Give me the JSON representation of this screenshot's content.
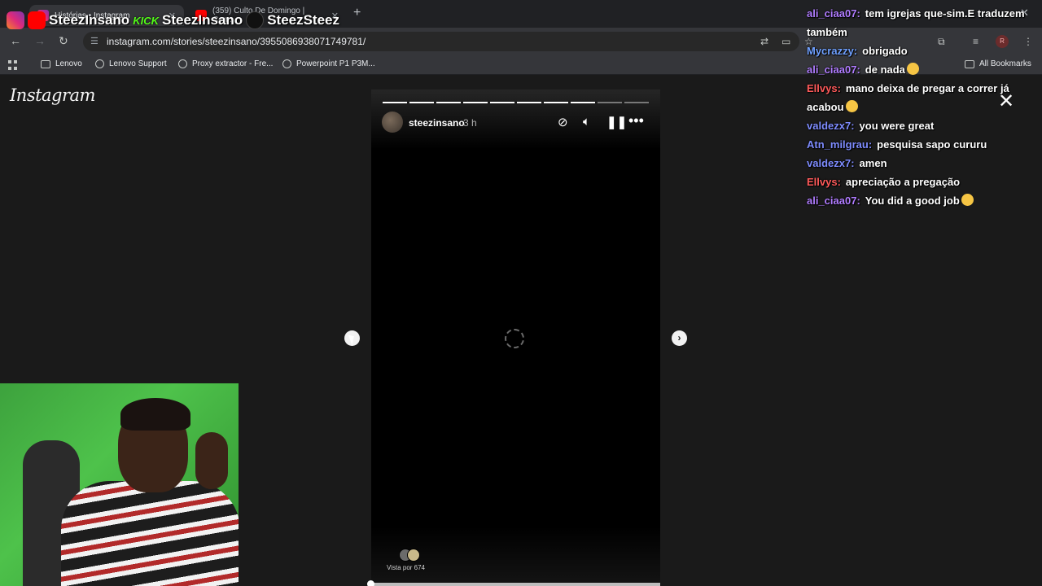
{
  "browser": {
    "tabs": [
      {
        "title": "Histórias • Instagram",
        "favicon": "instagram-icon",
        "active": true
      },
      {
        "title": "(359) Culto De Domingo | Com...",
        "favicon": "youtube-icon",
        "active": false
      }
    ],
    "new_tab": "+",
    "url": "instagram.com/stories/steezinsano/3955086938071749781/",
    "bookmarks": [
      {
        "label": "Lenovo",
        "icon": "folder-icon"
      },
      {
        "label": "Lenovo Support",
        "icon": "globe-icon"
      },
      {
        "label": "Proxy extractor - Fre...",
        "icon": "globe-icon"
      },
      {
        "label": "Powerpoint P1 P3M...",
        "icon": "globe-icon"
      }
    ],
    "all_bookmarks": "All Bookmarks",
    "profile_initial": "R"
  },
  "instagram": {
    "logo": "Instagram",
    "story": {
      "username": "steezinsano",
      "time": "3 h",
      "segments_total": 10,
      "segments_done": 8,
      "viewed_by": "Vista por 674"
    }
  },
  "overlay": {
    "channels": [
      "SteezInsano",
      "SteezInsano",
      "SteezSteez"
    ],
    "kick_label": "KICK",
    "chat": [
      {
        "user": "ali_ciaa07:",
        "text": "tem igrejas que-sim.E traduzem também",
        "color": "#b07cff"
      },
      {
        "user": "Mycrazzy:",
        "text": "obrigado",
        "color": "#6fa0ff"
      },
      {
        "user": "ali_ciaa07:",
        "text": "de nada",
        "color": "#b07cff",
        "emoji": true
      },
      {
        "user": "Ellvys:",
        "text": "mano deixa de pregar a correr já acabou",
        "color": "#ff5a5a",
        "emoji": true
      },
      {
        "user": "valdezx7:",
        "text": "you were great",
        "color": "#7e8cff"
      },
      {
        "user": "Atn_milgrau:",
        "text": "pesquisa sapo cururu",
        "color": "#7e8cff"
      },
      {
        "user": "valdezx7:",
        "text": "amen",
        "color": "#7e8cff"
      },
      {
        "user": "Ellvys:",
        "text": "apreciação a pregação",
        "color": "#ff5a5a"
      },
      {
        "user": "ali_ciaa07:",
        "text": "You did a good job",
        "color": "#b07cff",
        "emoji": true
      }
    ]
  }
}
